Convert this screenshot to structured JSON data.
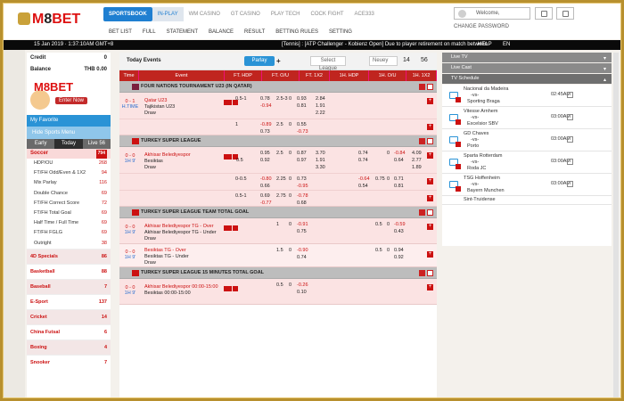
{
  "header": {
    "menu": [
      "SPORTSBOOK",
      "IN-PLAY",
      "WM CASINO",
      "GT CASINO",
      "PLAY TECH",
      "COCK FIGHT",
      "ACE333"
    ],
    "submenu": [
      "BET LIST",
      "FULL",
      "STATEMENT",
      "BALANCE",
      "RESULT",
      "BETTING RULES",
      "SETTING"
    ],
    "welcome": "Welcome,",
    "change_password": "CHANGE PASSWORD"
  },
  "ticker": {
    "datetime": "15 Jan 2019  ·  1:37:10AM GMT+8",
    "message": "[Tennis] : [ATP Challenger - Kobienz Open] Due to player retirement on match between",
    "help": "HELP",
    "lang": "EN"
  },
  "left": {
    "credit_label": "Credit",
    "credit_value": "0",
    "balance_label": "Balance",
    "balance_value": "THB 0.00",
    "promo_brand": "M8BET",
    "promo_enter": "Enter Now",
    "my_favorite": "My Favorite",
    "hide_menu": "Hide Sports Menu",
    "tabs": [
      "Early",
      "Today",
      "Live"
    ],
    "live_count": "56",
    "soccer": {
      "label": "Soccer",
      "count": "794"
    },
    "soccer_items": [
      {
        "label": "HDP/OU",
        "count": "268"
      },
      {
        "label": "FT/FH Odd/Even & 1X2",
        "count": "94"
      },
      {
        "label": "Mix Parlay",
        "count": "116"
      },
      {
        "label": "Double Chance",
        "count": "69"
      },
      {
        "label": "FT/FH Correct Score",
        "count": "72"
      },
      {
        "label": "FT/FH Total Goal",
        "count": "69"
      },
      {
        "label": "Half Time / Full Time",
        "count": "69"
      },
      {
        "label": "FT/FH FGLG",
        "count": "69"
      },
      {
        "label": "Outright",
        "count": "38"
      }
    ],
    "sports": [
      {
        "label": "4D Specials",
        "count": "86"
      },
      {
        "label": "Basketball",
        "count": "88"
      },
      {
        "label": "Baseball",
        "count": "7"
      },
      {
        "label": "E-Sport",
        "count": "137"
      },
      {
        "label": "Cricket",
        "count": "14"
      },
      {
        "label": "China Futsal",
        "count": "6"
      },
      {
        "label": "Boxing",
        "count": "4"
      },
      {
        "label": "Snooker",
        "count": "7"
      }
    ]
  },
  "main": {
    "title": "Today Events",
    "parlay": "Parlay",
    "select_league": "Select League",
    "sort": "Neuey",
    "count_a": "14",
    "count_b": "56",
    "columns": [
      "Time",
      "Event",
      "FT. HDP",
      "FT. O/U",
      "FT. 1X2",
      "1H. HDP",
      "1H. O/U",
      "1H. 1X2"
    ],
    "leagues": [
      {
        "name": "FOUR NATIONS TOURNAMENT U23 (IN QATAR)",
        "time": "0 - 1",
        "status": "H.TIME",
        "home": "Qatar U23",
        "away": "Tajikistan U23",
        "draw": "Draw",
        "rows": [
          {
            "hdp_l": "0.5-1",
            "hdp_h": "0.78",
            "hdp_a": "-0.94",
            "ou_l": "2.5-3",
            "ou_o": "0",
            "ou_h": "0.93",
            "ou_a": "0.81",
            "x1": "2.84",
            "x2": "1.91",
            "xd": "2.22"
          },
          {
            "hdp_l": "1",
            "hdp_h": "-0.89",
            "hdp_a": "0.73",
            "ou_l": "2.5",
            "ou_o": "0",
            "ou_h": "0.55",
            "ou_a": "-0.73"
          }
        ]
      },
      {
        "name": "TURKEY SUPER LEAGUE",
        "time": "0 - 0",
        "status": "1H 9'",
        "home": "Akhisar Belediyespor",
        "away": "Besiktas",
        "draw": "Draw",
        "rows": [
          {
            "hdp_h": "0.95",
            "hdp_l2": "0.5",
            "hdp_a": "0.92",
            "ou_l": "2.5",
            "ou_o": "0",
            "ou_h": "0.87",
            "ou_a": "0.97",
            "x1": "3.70",
            "x2": "1.91",
            "xd": "3.30",
            "h1_h": "0.74",
            "h1_a": "0.74",
            "h1ou_o": "0",
            "h1ou_h": "-0.84",
            "h1ou_a": "0.64",
            "h1x1": "4.09",
            "h1x2": "2.77",
            "h1xd": "1.89"
          },
          {
            "hdp_h": "-0.80",
            "hdp_l": "0-0.5",
            "hdp_a": "0.66",
            "ou_l": "2.25",
            "ou_o": "0",
            "ou_h": "0.73",
            "ou_a": "-0.95",
            "h1_h": "-0.64",
            "h1_a": "0.54",
            "h1ou_l": "0.75",
            "h1ou_o": "0",
            "h1ou_h": "0.71",
            "h1ou_a": "0.81"
          },
          {
            "hdp_h": "0.69",
            "hdp_l": "0.5-1",
            "hdp_a": "-0.77",
            "ou_l": "2.75",
            "ou_o": "0",
            "ou_h": "-0.78",
            "ou_a": "0.68"
          }
        ]
      },
      {
        "name": "TURKEY SUPER LEAGUE TEAM TOTAL GOAL",
        "time": "0 - 0",
        "status": "1H 9'",
        "home": "Akhisar Belediyespor TG - Over",
        "away": "Akhisar Belediyespor TG - Under",
        "draw": "Draw",
        "rows": [
          {
            "ou_l": "1",
            "ou_o": "0",
            "ou_h": "-0.91",
            "ou_a": "0.75",
            "h1ou_l": "0.5",
            "h1ou_o": "0",
            "h1ou_h": "-0.59",
            "h1ou_a": "0.43"
          }
        ],
        "second": {
          "home": "Besiktas TG - Over",
          "away": "Besiktas TG - Under",
          "draw": "Draw",
          "ou_l": "1.5",
          "ou_o": "0",
          "ou_h": "-0.90",
          "ou_a": "0.74",
          "h1ou_l": "0.5",
          "h1ou_o": "0",
          "h1ou_h": "0.94",
          "h1ou_a": "0.92"
        }
      },
      {
        "name": "TURKEY SUPER LEAGUE 15 MINUTES TOTAL GOAL",
        "time": "0 - 0",
        "status": "1H 9'",
        "home": "Akhisar Belediyespor 00:00-15:00",
        "away": "Besiktas 00:00-15:00",
        "rows": [
          {
            "ou_l": "0.5",
            "ou_o": "0",
            "ou_h": "-0.26",
            "ou_a": "0.10"
          }
        ]
      }
    ]
  },
  "right": {
    "live_tv": "Live TV",
    "live_cast": "Live Cast",
    "tv_schedule": "TV Schedule",
    "schedule": [
      {
        "home": "Nacional da Madeira",
        "vs": "-vs-",
        "away": "Sporting Braga",
        "time": "02:45AM"
      },
      {
        "home": "Vitesse Arnhem",
        "vs": "-vs-",
        "away": "Excelsior SBV",
        "time": "03:00AM"
      },
      {
        "home": "GD Chaves",
        "vs": "-vs-",
        "away": "Porto",
        "time": "03:00AM"
      },
      {
        "home": "Sparta Rotterdam",
        "vs": "-vs-",
        "away": "Roda JC",
        "time": "03:00AM"
      },
      {
        "home": "TSG Hoffenheim",
        "vs": "-vs-",
        "away": "Bayern Munchen",
        "time": "03:00AM"
      },
      {
        "home": "Sint-Truidense",
        "vs": "",
        "away": "",
        "time": ""
      }
    ]
  },
  "colors": {
    "accent": "#1f7fd1",
    "red": "#c0251f",
    "gold": "#b8902e"
  }
}
